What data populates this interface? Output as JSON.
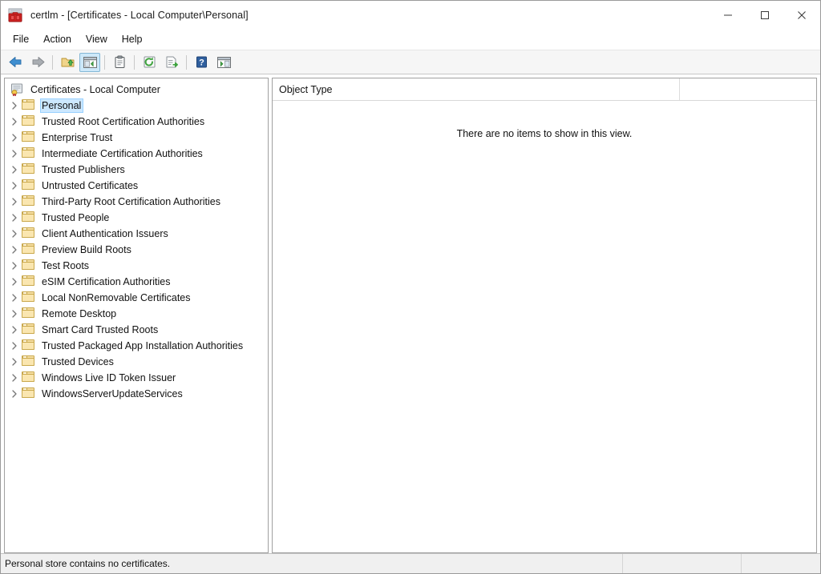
{
  "window": {
    "title": "certlm - [Certificates - Local Computer\\Personal]",
    "app_icon": "certificate-store-icon",
    "controls": {
      "minimize": "minimize-icon",
      "maximize": "maximize-icon",
      "close": "close-icon"
    }
  },
  "menubar": {
    "items": [
      {
        "label": "File"
      },
      {
        "label": "Action"
      },
      {
        "label": "View"
      },
      {
        "label": "Help"
      }
    ]
  },
  "toolbar": {
    "buttons": [
      {
        "name": "back-icon",
        "tooltip": "Back",
        "pressed": false
      },
      {
        "name": "forward-icon",
        "tooltip": "Forward",
        "pressed": false
      },
      {
        "name": "up-one-level-icon",
        "tooltip": "Up One Level",
        "pressed": false
      },
      {
        "name": "show-hide-console-tree-icon",
        "tooltip": "Show/Hide Console Tree",
        "pressed": true
      },
      {
        "name": "properties-icon",
        "tooltip": "Properties",
        "pressed": false
      },
      {
        "name": "refresh-icon",
        "tooltip": "Refresh",
        "pressed": false
      },
      {
        "name": "export-list-icon",
        "tooltip": "Export List",
        "pressed": false
      },
      {
        "name": "help-icon",
        "tooltip": "Help",
        "pressed": false
      },
      {
        "name": "show-hide-action-pane-icon",
        "tooltip": "Show/Hide Action Pane",
        "pressed": false
      }
    ]
  },
  "tree": {
    "root": {
      "label": "Certificates - Local Computer",
      "icon": "certificate-store-icon"
    },
    "items": [
      {
        "label": "Personal",
        "icon": "folder-icon",
        "selected": true
      },
      {
        "label": "Trusted Root Certification Authorities",
        "icon": "folder-icon",
        "selected": false
      },
      {
        "label": "Enterprise Trust",
        "icon": "folder-icon",
        "selected": false
      },
      {
        "label": "Intermediate Certification Authorities",
        "icon": "folder-icon",
        "selected": false
      },
      {
        "label": "Trusted Publishers",
        "icon": "folder-icon",
        "selected": false
      },
      {
        "label": "Untrusted Certificates",
        "icon": "folder-icon",
        "selected": false
      },
      {
        "label": "Third-Party Root Certification Authorities",
        "icon": "folder-icon",
        "selected": false
      },
      {
        "label": "Trusted People",
        "icon": "folder-icon",
        "selected": false
      },
      {
        "label": "Client Authentication Issuers",
        "icon": "folder-icon",
        "selected": false
      },
      {
        "label": "Preview Build Roots",
        "icon": "folder-icon",
        "selected": false
      },
      {
        "label": "Test Roots",
        "icon": "folder-icon",
        "selected": false
      },
      {
        "label": "eSIM Certification Authorities",
        "icon": "folder-icon",
        "selected": false
      },
      {
        "label": "Local NonRemovable Certificates",
        "icon": "folder-icon",
        "selected": false
      },
      {
        "label": "Remote Desktop",
        "icon": "folder-icon",
        "selected": false
      },
      {
        "label": "Smart Card Trusted Roots",
        "icon": "folder-icon",
        "selected": false
      },
      {
        "label": "Trusted Packaged App Installation Authorities",
        "icon": "folder-icon",
        "selected": false
      },
      {
        "label": "Trusted Devices",
        "icon": "folder-icon",
        "selected": false
      },
      {
        "label": "Windows Live ID Token Issuer",
        "icon": "folder-icon",
        "selected": false
      },
      {
        "label": "WindowsServerUpdateServices",
        "icon": "folder-icon",
        "selected": false
      }
    ]
  },
  "list": {
    "columns": [
      {
        "label": "Object Type"
      },
      {
        "label": ""
      }
    ],
    "empty_message": "There are no items to show in this view.",
    "rows": []
  },
  "statusbar": {
    "message": "Personal store contains no certificates.",
    "segment2": "",
    "segment3": ""
  },
  "colors": {
    "selection": "#cce8ff",
    "selection_border": "#99d1ff",
    "toolbar_bg": "#f6f6f6",
    "statusbar_bg": "#f0f0f0",
    "folder": "#f6dfa4",
    "accent_red": "#c0392b"
  }
}
